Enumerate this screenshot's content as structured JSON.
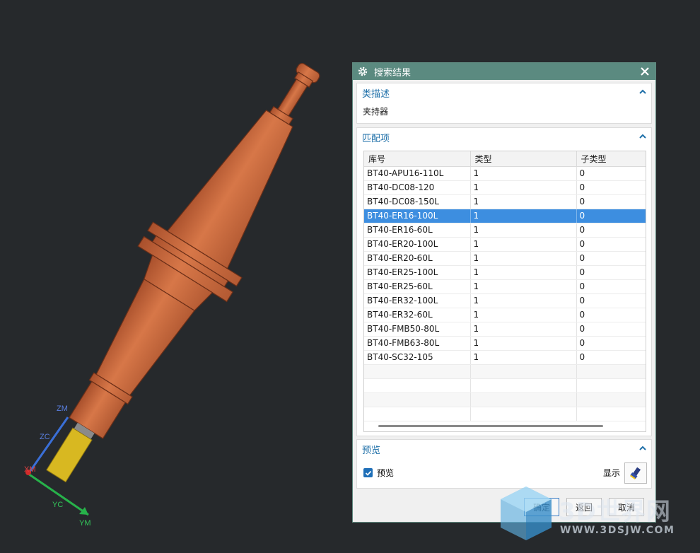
{
  "viewport": {
    "axes": {
      "zm": "ZM",
      "zc": "ZC",
      "xm": "XM",
      "yc": "YC",
      "ym": "YM"
    }
  },
  "dialog": {
    "title": "搜索结果",
    "title_icon": "gear-icon",
    "close_icon": "close-icon",
    "class_desc": {
      "header": "类描述",
      "value": "夹持器"
    },
    "matches": {
      "header": "匹配项",
      "columns": [
        "库号",
        "类型",
        "子类型"
      ],
      "rows": [
        [
          "BT40-APU16-110L",
          "1",
          "0"
        ],
        [
          "BT40-DC08-120",
          "1",
          "0"
        ],
        [
          "BT40-DC08-150L",
          "1",
          "0"
        ],
        [
          "BT40-ER16-100L",
          "1",
          "0"
        ],
        [
          "BT40-ER16-60L",
          "1",
          "0"
        ],
        [
          "BT40-ER20-100L",
          "1",
          "0"
        ],
        [
          "BT40-ER20-60L",
          "1",
          "0"
        ],
        [
          "BT40-ER25-100L",
          "1",
          "0"
        ],
        [
          "BT40-ER25-60L",
          "1",
          "0"
        ],
        [
          "BT40-ER32-100L",
          "1",
          "0"
        ],
        [
          "BT40-ER32-60L",
          "1",
          "0"
        ],
        [
          "BT40-FMB50-80L",
          "1",
          "0"
        ],
        [
          "BT40-FMB63-80L",
          "1",
          "0"
        ],
        [
          "BT40-SC32-105",
          "1",
          "0"
        ]
      ],
      "selected_row": "BT40-ER16-100L"
    },
    "preview": {
      "header": "预览",
      "checkbox_label": "预览",
      "checked": true,
      "show_label": "显示",
      "show_icon": "flashlight-icon"
    },
    "buttons": {
      "ok": "确定",
      "back": "返回",
      "cancel": "取消"
    }
  },
  "watermark": {
    "brand": "3D世界网",
    "url": "WWW.3DSJW.COM"
  },
  "colors": {
    "background": "#26292c",
    "titlebar": "#5b8a80",
    "accent": "#1e6fa8",
    "selection": "#3d8ee0",
    "tool_body": "#c8643c"
  }
}
